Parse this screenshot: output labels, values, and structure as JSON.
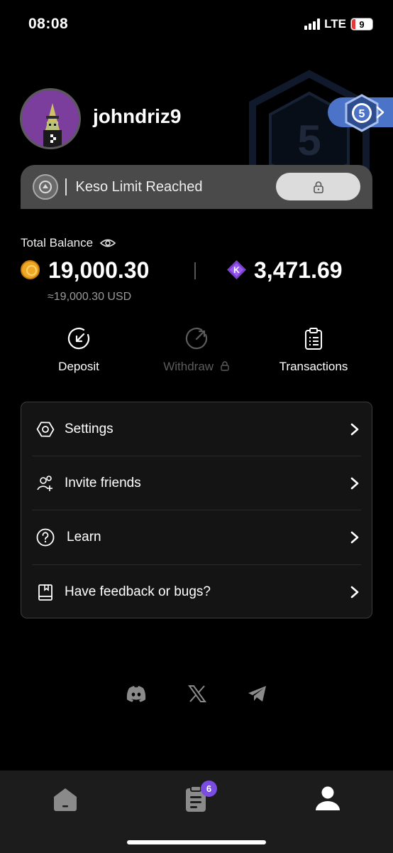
{
  "status": {
    "time": "08:08",
    "network": "LTE",
    "battery": "9"
  },
  "profile": {
    "username": "johndriz9",
    "level": "5",
    "level_bg": "5"
  },
  "keso": {
    "text": "Keso Limit Reached"
  },
  "balance": {
    "label": "Total Balance",
    "coins": "19,000.30",
    "keso": "3,471.69",
    "usd": "≈19,000.30 USD"
  },
  "actions": [
    {
      "label": "Deposit",
      "icon": "deposit-icon",
      "enabled": true
    },
    {
      "label": "Withdraw",
      "icon": "withdraw-icon",
      "enabled": false
    },
    {
      "label": "Transactions",
      "icon": "transactions-icon",
      "enabled": true
    }
  ],
  "menu": [
    {
      "label": "Settings",
      "icon": "settings-icon"
    },
    {
      "label": "Invite friends",
      "icon": "invite-friends-icon"
    },
    {
      "label": "Learn",
      "icon": "help-icon"
    },
    {
      "label": "Have feedback or bugs?",
      "icon": "feedback-book-icon"
    }
  ],
  "socials": [
    "discord-icon",
    "x-icon",
    "telegram-icon"
  ],
  "tabs": [
    {
      "icon": "home-icon",
      "active": false
    },
    {
      "icon": "tasks-icon",
      "active": false,
      "badge": "6"
    },
    {
      "icon": "profile-icon",
      "active": true
    }
  ],
  "colors": {
    "accent_blue": "#4b73c7",
    "coin_gold": "#f0a726",
    "gem_purple": "#7b4ce0",
    "badge": "#7b4ce0"
  }
}
